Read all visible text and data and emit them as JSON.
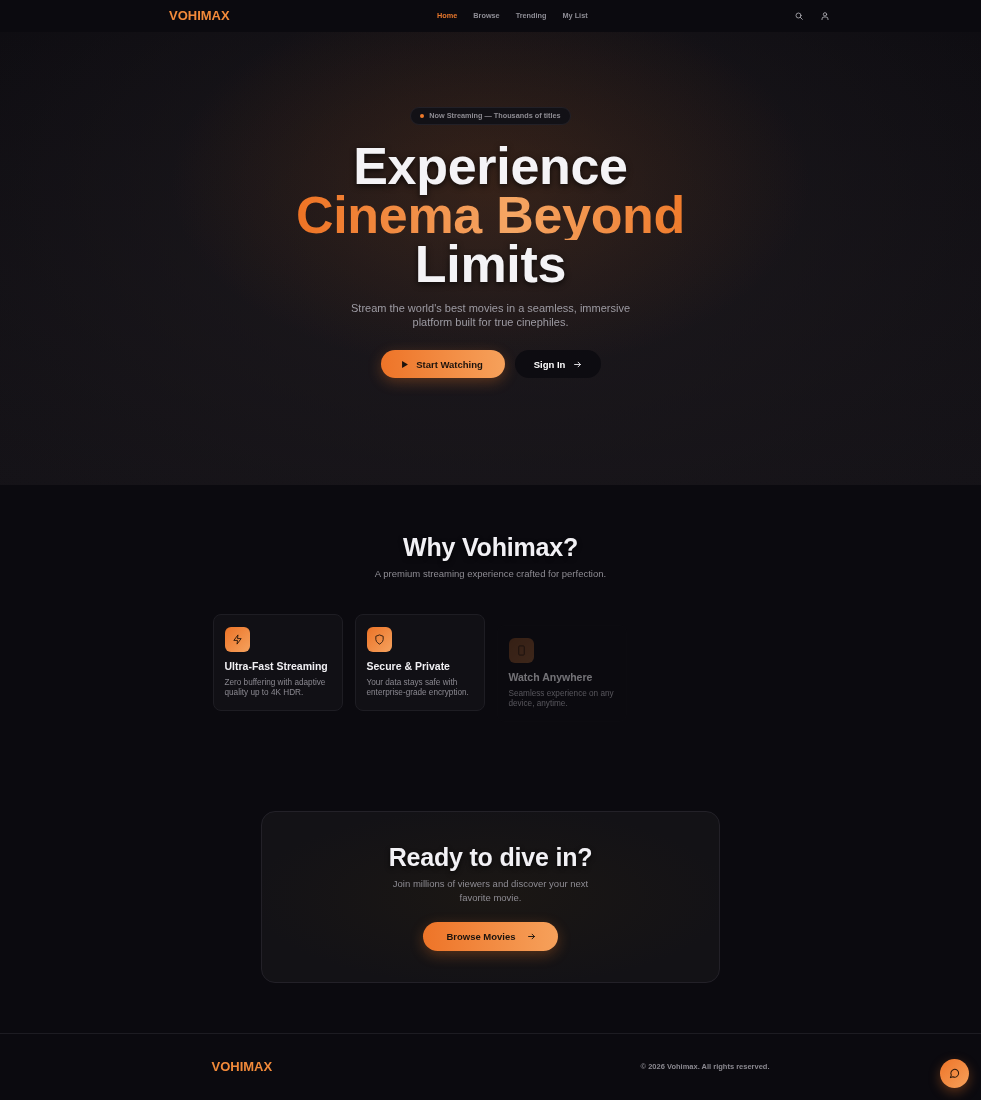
{
  "nav": {
    "logo": "VOHIMAX",
    "links": [
      {
        "label": "Home",
        "selected": true
      },
      {
        "label": "Browse",
        "selected": false
      },
      {
        "label": "Trending",
        "selected": false
      },
      {
        "label": "My List",
        "selected": false
      }
    ]
  },
  "hero": {
    "badge": "Now Streaming — Thousands of titles",
    "headline": [
      {
        "text": "Experience",
        "accent": false
      },
      {
        "text": "Cinema Beyond",
        "accent": true
      },
      {
        "text": "Limits",
        "accent": false
      }
    ],
    "subtitle": "Stream the world's best movies in a seamless, immersive platform built for true cinephiles.",
    "buttons": [
      {
        "label": "Start Watching",
        "kind": "primary"
      },
      {
        "label": "Sign In",
        "kind": "secondary"
      }
    ]
  },
  "features": {
    "title": "Why Vohimax?",
    "subtitle": "A premium streaming experience crafted for perfection.",
    "cards": [
      {
        "kind": "bolt",
        "title": "Ultra-Fast Streaming",
        "text": "Zero buffering with adaptive quality up to 4K HDR.",
        "dimmed": false
      },
      {
        "kind": "shield",
        "title": "Secure & Private",
        "text": "Your data stays safe with enterprise-grade encryption.",
        "dimmed": false
      },
      {
        "kind": "phone",
        "title": "Watch Anywhere",
        "text": "Seamless experience on any device, anytime.",
        "dimmed": true
      }
    ]
  },
  "cta": {
    "title": "Ready to dive in?",
    "text": "Join millions of viewers and discover your next favorite movie.",
    "button": "Browse Movies"
  },
  "footer": {
    "logo": "VOHIMAX",
    "copyright": "© 2026 Vohimax. All rights reserved."
  }
}
